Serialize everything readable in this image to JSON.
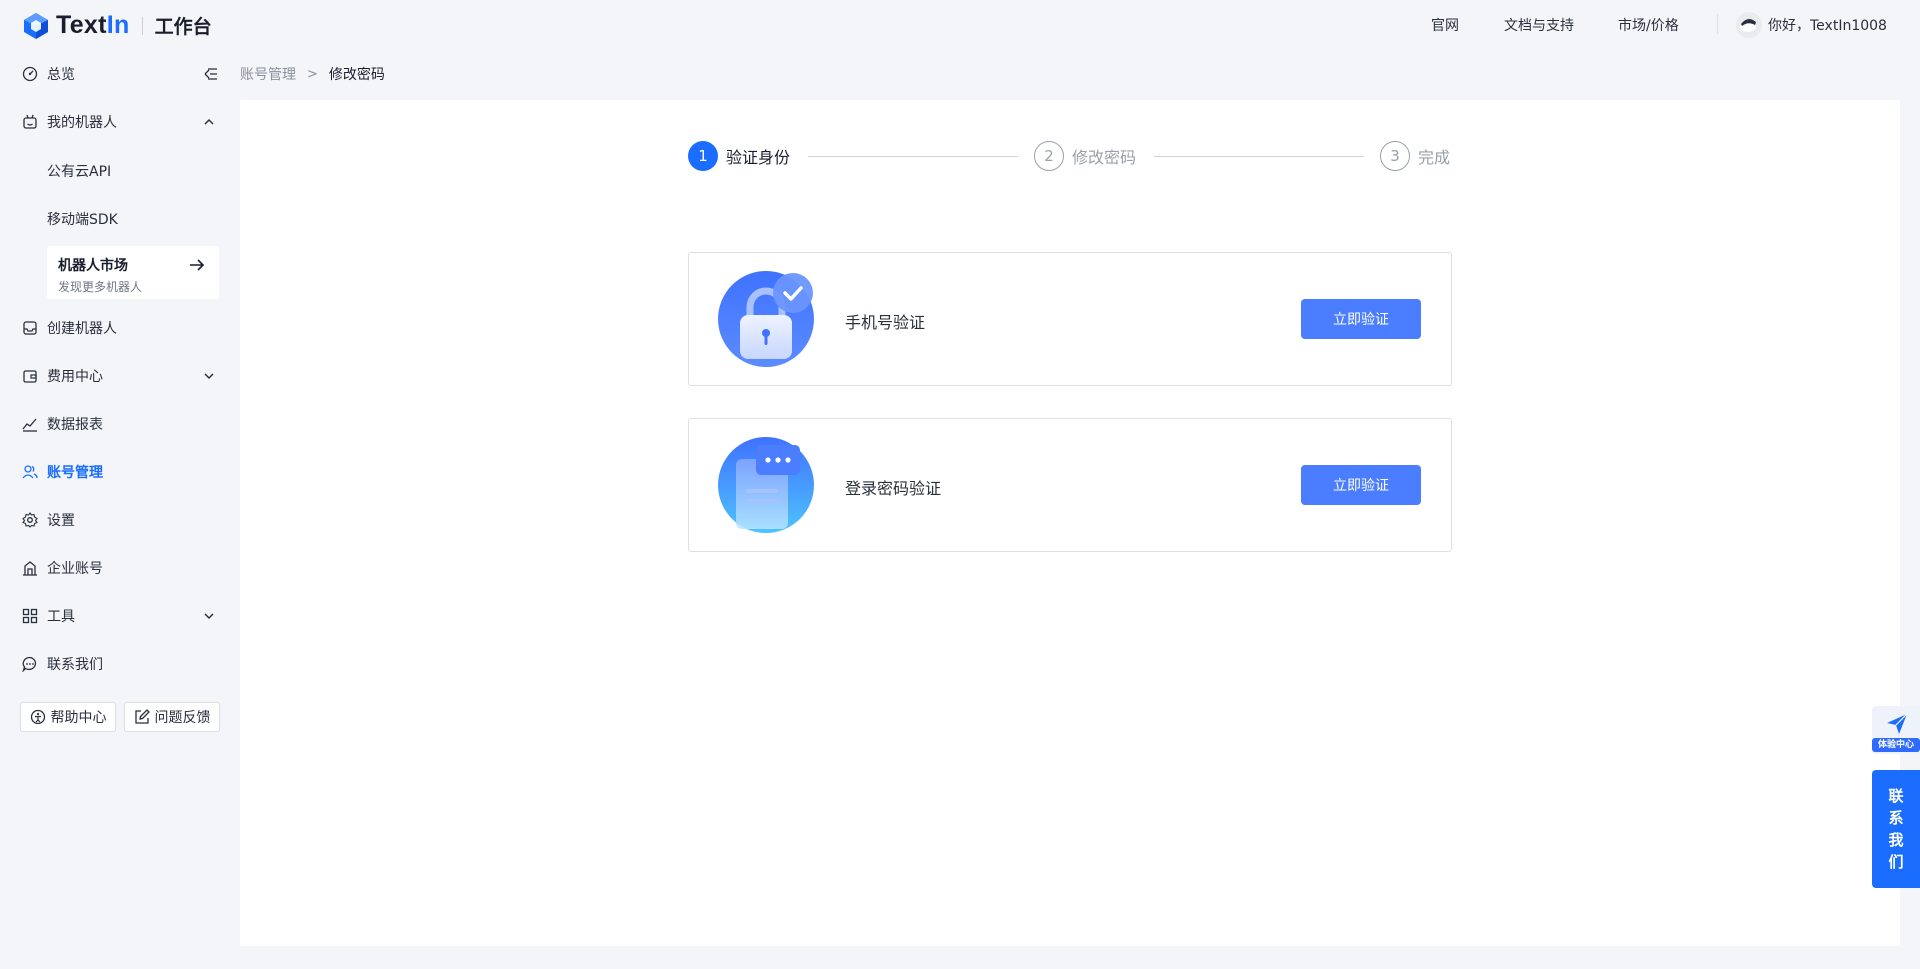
{
  "brand": {
    "name_a": "Text",
    "name_b": "In",
    "subtitle": "工作台"
  },
  "topnav": {
    "home": "官网",
    "docs": "文档与支持",
    "market": "市场/价格",
    "greeting": "你好，TextIn1008"
  },
  "sidebar": {
    "overview": "总览",
    "my_robots": "我的机器人",
    "sub_public_api": "公有云API",
    "sub_mobile_sdk": "移动端SDK",
    "market_title": "机器人市场",
    "market_sub": "发现更多机器人",
    "create_robot": "创建机器人",
    "billing": "费用中心",
    "reports": "数据报表",
    "account": "账号管理",
    "settings": "设置",
    "enterprise": "企业账号",
    "tools": "工具",
    "contact": "联系我们",
    "help_btn": "帮助中心",
    "feedback_btn": "问题反馈"
  },
  "breadcrumb": {
    "parent": "账号管理",
    "current": "修改密码",
    "separator": ">"
  },
  "steps": [
    {
      "num": "1",
      "label": "验证身份"
    },
    {
      "num": "2",
      "label": "修改密码"
    },
    {
      "num": "3",
      "label": "完成"
    }
  ],
  "cards": {
    "phone": {
      "title": "手机号验证",
      "button": "立即验证"
    },
    "password": {
      "title": "登录密码验证",
      "button": "立即验证"
    }
  },
  "float": {
    "experience": "体验中心",
    "contact_1": "联",
    "contact_2": "系",
    "contact_3": "我",
    "contact_4": "们"
  },
  "colors": {
    "primary": "#1a6dff",
    "button": "#4a7dff",
    "background": "#f3f5f9"
  }
}
